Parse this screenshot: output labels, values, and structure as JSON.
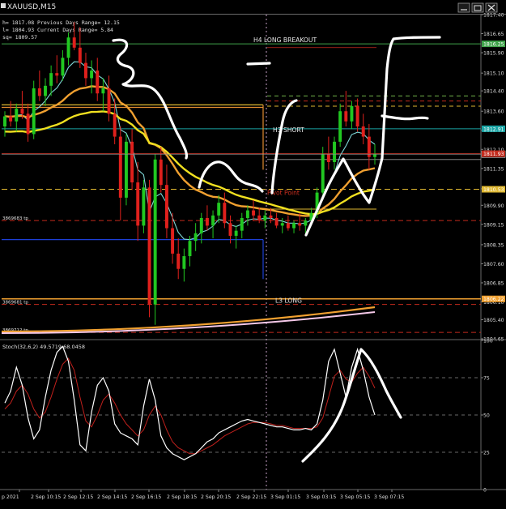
{
  "window": {
    "title": "XAUUSD,M15",
    "controls": [
      "minimize-icon",
      "restore-icon",
      "close-icon"
    ]
  },
  "info_lines": [
    "h= 1817.08   Previous Days Range= 12.15",
    "l= 1804.93   Current Days Range= 5.84",
    "sq= 1809.57"
  ],
  "main_chart": {
    "ticks": [
      "1817.40",
      "1816.65",
      "1815.90",
      "1815.10",
      "1814.40",
      "1813.60",
      "1812.85",
      "1812.10",
      "1811.35",
      "1810.55",
      "1809.90",
      "1809.15",
      "1808.35",
      "1807.60",
      "1806.85",
      "1806.10",
      "1805.40",
      "1804.65"
    ],
    "ylim": [
      1804.65,
      1817.4
    ],
    "current_price": "1811.91",
    "price_tags": [
      {
        "label": "1816.25",
        "value": 1816.25,
        "color": "#3fa34a"
      },
      {
        "label": "1812.91",
        "value": 1812.91,
        "color": "#1aa4a4"
      },
      {
        "label": "1811.93",
        "value": 1811.93,
        "color": "#c22a1c"
      },
      {
        "label": "1810.53",
        "value": 1810.53,
        "color": "#e0b830"
      },
      {
        "label": "1806.22",
        "value": 1806.22,
        "color": "#f0a030"
      }
    ],
    "left_tags": [
      {
        "label": "3869683 tp",
        "value": 1809.3
      },
      {
        "label": "3869681 tp",
        "value": 1806.0
      },
      {
        "label": "3869712 tp",
        "value": 1804.9
      }
    ],
    "levels": [
      {
        "label": "H4 LONG BREAKOUT",
        "value": 1816.25,
        "color": "#3fa34a"
      },
      {
        "label": "H3 SHORT",
        "value": 1812.91,
        "color": "#1aa4a4"
      },
      {
        "label": "Pivot Point",
        "value": 1810.53,
        "color": "#e0b830"
      },
      {
        "label": "L3 LONG",
        "value": 1806.22,
        "color": "#f0a030"
      }
    ]
  },
  "stoch_panel": {
    "title": "Stoch(32,6,2) 49.5719 68.0458",
    "ticks": [
      "100",
      "75",
      "50",
      "25",
      "0"
    ],
    "ylim": [
      0,
      100
    ]
  },
  "time_axis": {
    "labels": [
      "p 2021",
      "2 Sep 10:15",
      "2 Sep 12:15",
      "2 Sep 14:15",
      "2 Sep 16:15",
      "2 Sep 18:15",
      "2 Sep 20:15",
      "2 Sep 22:15",
      "3 Sep 01:15",
      "3 Sep 03:15",
      "3 Sep 05:15",
      "3 Sep 07:15"
    ]
  },
  "chart_data": {
    "type": "candlestick",
    "symbol": "XAUUSD,M15",
    "candles": [
      [
        1813.0,
        1813.6,
        1812.6,
        1813.4
      ],
      [
        1813.4,
        1814.0,
        1813.0,
        1813.2
      ],
      [
        1813.2,
        1813.9,
        1812.8,
        1813.7
      ],
      [
        1813.7,
        1814.4,
        1813.3,
        1813.5
      ],
      [
        1813.5,
        1813.9,
        1812.4,
        1812.7
      ],
      [
        1812.7,
        1814.8,
        1812.5,
        1814.5
      ],
      [
        1814.5,
        1815.2,
        1814.0,
        1814.2
      ],
      [
        1814.2,
        1814.9,
        1813.8,
        1814.6
      ],
      [
        1814.6,
        1815.4,
        1814.2,
        1815.1
      ],
      [
        1815.1,
        1815.8,
        1814.7,
        1815.0
      ],
      [
        1815.0,
        1816.0,
        1814.8,
        1815.7
      ],
      [
        1815.7,
        1816.7,
        1815.4,
        1816.5
      ],
      [
        1816.5,
        1817.1,
        1816.0,
        1816.1
      ],
      [
        1816.1,
        1816.9,
        1815.3,
        1815.5
      ],
      [
        1815.5,
        1815.9,
        1814.6,
        1814.9
      ],
      [
        1814.9,
        1815.6,
        1814.3,
        1815.2
      ],
      [
        1815.2,
        1815.7,
        1814.0,
        1814.3
      ],
      [
        1814.3,
        1814.9,
        1813.6,
        1814.5
      ],
      [
        1814.5,
        1815.0,
        1813.2,
        1813.5
      ],
      [
        1813.5,
        1814.1,
        1812.3,
        1812.6
      ],
      [
        1812.6,
        1813.0,
        1809.3,
        1810.2
      ],
      [
        1810.2,
        1812.7,
        1809.9,
        1812.4
      ],
      [
        1812.4,
        1812.9,
        1810.5,
        1810.8
      ],
      [
        1810.8,
        1811.6,
        1808.5,
        1809.1
      ],
      [
        1809.1,
        1810.9,
        1808.8,
        1810.6
      ],
      [
        1810.6,
        1810.9,
        1805.5,
        1806.0
      ],
      [
        1806.0,
        1811.9,
        1805.2,
        1811.7
      ],
      [
        1811.7,
        1812.2,
        1810.4,
        1810.7
      ],
      [
        1810.7,
        1811.5,
        1808.6,
        1809.0
      ],
      [
        1809.0,
        1809.6,
        1807.6,
        1808.0
      ],
      [
        1808.0,
        1808.6,
        1807.0,
        1807.4
      ],
      [
        1807.4,
        1808.2,
        1806.9,
        1807.9
      ],
      [
        1807.9,
        1808.7,
        1807.5,
        1808.5
      ],
      [
        1808.5,
        1809.2,
        1808.1,
        1808.8
      ],
      [
        1808.8,
        1809.6,
        1808.4,
        1809.4
      ],
      [
        1809.4,
        1809.9,
        1808.9,
        1809.1
      ],
      [
        1809.1,
        1809.7,
        1808.6,
        1809.5
      ],
      [
        1809.5,
        1810.3,
        1809.2,
        1810.0
      ],
      [
        1810.0,
        1810.4,
        1809.0,
        1809.2
      ],
      [
        1809.2,
        1809.5,
        1808.4,
        1808.7
      ],
      [
        1808.7,
        1809.1,
        1808.2,
        1808.9
      ],
      [
        1808.9,
        1809.6,
        1808.6,
        1809.4
      ],
      [
        1809.4,
        1809.9,
        1809.1,
        1809.7
      ],
      [
        1809.7,
        1810.1,
        1809.3,
        1809.5
      ],
      [
        1809.5,
        1809.8,
        1809.2,
        1809.3
      ],
      [
        1809.3,
        1809.7,
        1809.0,
        1809.5
      ],
      [
        1809.5,
        1809.8,
        1809.2,
        1809.4
      ],
      [
        1809.4,
        1809.6,
        1809.0,
        1809.1
      ],
      [
        1809.1,
        1809.4,
        1808.8,
        1809.2
      ],
      [
        1809.2,
        1809.5,
        1808.9,
        1809.0
      ],
      [
        1809.0,
        1809.3,
        1808.8,
        1809.2
      ],
      [
        1809.2,
        1809.6,
        1808.9,
        1809.1
      ],
      [
        1809.1,
        1809.4,
        1808.8,
        1809.3
      ],
      [
        1809.3,
        1809.8,
        1809.1,
        1809.6
      ],
      [
        1809.6,
        1810.6,
        1809.4,
        1810.4
      ],
      [
        1810.4,
        1812.2,
        1810.1,
        1811.9
      ],
      [
        1811.9,
        1812.6,
        1811.3,
        1811.6
      ],
      [
        1811.6,
        1812.6,
        1811.3,
        1812.4
      ],
      [
        1812.4,
        1813.9,
        1812.2,
        1813.6
      ],
      [
        1813.6,
        1814.4,
        1813.0,
        1813.2
      ],
      [
        1813.2,
        1814.0,
        1812.9,
        1813.8
      ],
      [
        1813.8,
        1814.1,
        1812.8,
        1813.0
      ],
      [
        1813.0,
        1813.5,
        1812.3,
        1812.6
      ],
      [
        1812.6,
        1813.1,
        1811.3,
        1811.8
      ],
      [
        1811.8,
        1812.3,
        1811.5,
        1811.9
      ]
    ],
    "ylim": [
      1804.65,
      1817.4
    ],
    "stochastic": {
      "name": "Stoch(32,6,2)",
      "main_value": 49.5719,
      "signal_value": 68.0458
    }
  }
}
